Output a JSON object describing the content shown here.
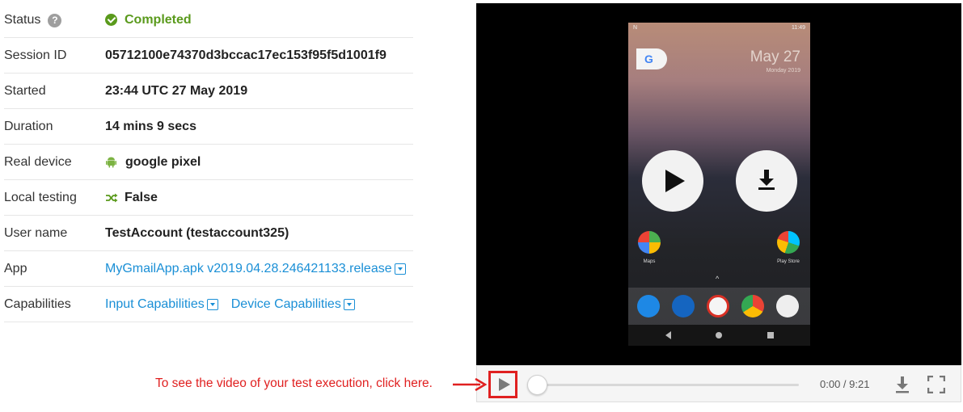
{
  "details": {
    "status": {
      "label": "Status",
      "help": "?",
      "value": "Completed"
    },
    "session_id": {
      "label": "Session ID",
      "value": "05712100e74370d3bccac17ec153f95f5d1001f9"
    },
    "started": {
      "label": "Started",
      "value": "23:44 UTC 27 May 2019"
    },
    "duration": {
      "label": "Duration",
      "value": "14 mins 9 secs"
    },
    "real_device": {
      "label": "Real device",
      "value": "google pixel"
    },
    "local_testing": {
      "label": "Local testing",
      "value": "False"
    },
    "user_name": {
      "label": "User name",
      "value": "TestAccount (testaccount325)"
    },
    "app": {
      "label": "App",
      "value": "MyGmailApp.apk v2019.04.28.246421133.release"
    },
    "capabilities": {
      "label": "Capabilities",
      "input": "Input Capabilities",
      "device": "Device Capabilities"
    }
  },
  "phone": {
    "status_left": "N",
    "clock": "11:49",
    "google_letter": "G",
    "date": "May 27",
    "weekday": "Monday 2019",
    "apps": {
      "maps": "Maps",
      "play_store": "Play Store"
    },
    "caret": "^"
  },
  "player": {
    "time": "0:00 / 9:21",
    "progress": 0
  },
  "annotation": {
    "hint": "To see the video of your test execution, click here."
  },
  "colors": {
    "accent_link": "#1a8fd6",
    "success": "#5a9a1c",
    "annotation": "#e02020"
  }
}
